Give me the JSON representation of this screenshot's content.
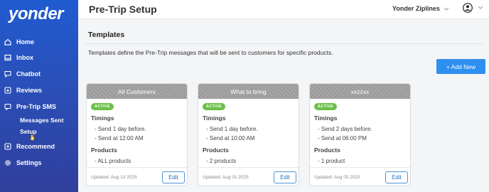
{
  "sidebar": {
    "logo": "yonder",
    "items": [
      {
        "label": "Home",
        "icon": "home-icon"
      },
      {
        "label": "Inbox",
        "icon": "inbox-icon"
      },
      {
        "label": "Chatbot",
        "icon": "chat-icon"
      },
      {
        "label": "Reviews",
        "icon": "reviews-icon"
      },
      {
        "label": "Pre-Trip SMS",
        "icon": "sms-icon"
      },
      {
        "label": "Recommend",
        "icon": "recommend-icon"
      },
      {
        "label": "Settings",
        "icon": "settings-icon"
      }
    ],
    "sub_items": [
      {
        "label": "Messages Sent"
      },
      {
        "label": "Setup"
      }
    ]
  },
  "header": {
    "title": "Pre-Trip Setup",
    "company": "Yonder Ziplines"
  },
  "main": {
    "section_title": "Templates",
    "description": "Templates define the Pre-Trip messages that will be sent to customers for specific products.",
    "add_button": "+ Add New",
    "cards": [
      {
        "title": "All Customers",
        "status": "ACTIVE",
        "timings_label": "Timings",
        "timings": [
          "- Send 1 day before.",
          "- Send at 12:00 AM"
        ],
        "products_label": "Products",
        "products": [
          "- ALL products"
        ],
        "updated": "Updated: Aug 13 2025",
        "edit": "Edit"
      },
      {
        "title": "What to bring",
        "status": "ACTIVE",
        "timings_label": "Timings",
        "timings": [
          "- Send 1 day before.",
          "- Send at 10:00 AM"
        ],
        "products_label": "Products",
        "products": [
          "- 2 products"
        ],
        "updated": "Updated: Aug 01 2025",
        "edit": "Edit"
      },
      {
        "title": "xxzzxx",
        "status": "ACTIVE",
        "timings_label": "Timings",
        "timings": [
          "- Send 2 days before.",
          "- Send at 06:00 PM"
        ],
        "products_label": "Products",
        "products": [
          "- 1 product"
        ],
        "updated": "Updated: Aug 05 2025",
        "edit": "Edit"
      }
    ]
  },
  "colors": {
    "sidebar": "#2a4fb8",
    "primary_button": "#2f8ff0",
    "active_badge": "#6cc04a",
    "card_header": "#a1a1a1"
  }
}
